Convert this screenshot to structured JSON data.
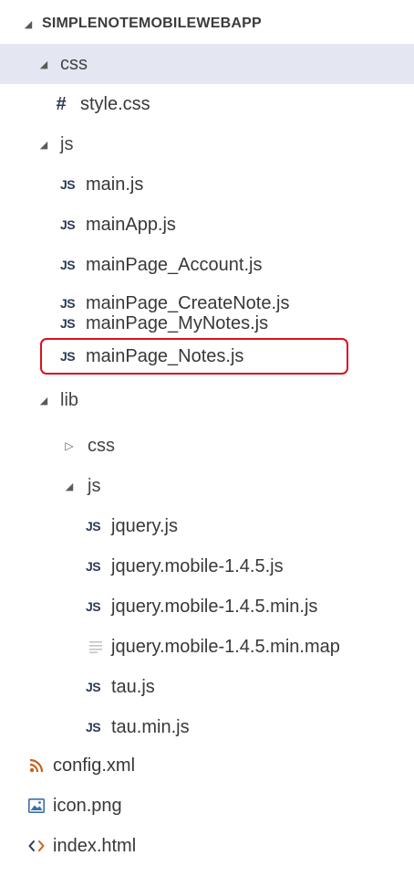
{
  "tree": {
    "root": {
      "label": "SIMPLENOTEMOBILEWEBAPP"
    },
    "css_folder": {
      "label": "css"
    },
    "style_css": {
      "label": "style.css"
    },
    "js_folder": {
      "label": "js"
    },
    "main_js": {
      "label": "main.js"
    },
    "mainApp_js": {
      "label": "mainApp.js"
    },
    "mainPage_Account_js": {
      "label": "mainPage_Account.js"
    },
    "mainPage_CreateNote_js": {
      "label": "mainPage_CreateNote.js"
    },
    "mainPage_MyNotes_js": {
      "label": "mainPage_MyNotes.js"
    },
    "mainPage_Notes_js": {
      "label": "mainPage_Notes.js"
    },
    "lib_folder": {
      "label": "lib"
    },
    "lib_css_folder": {
      "label": "css"
    },
    "lib_js_folder": {
      "label": "js"
    },
    "jquery_js": {
      "label": "jquery.js"
    },
    "jquery_mobile_js": {
      "label": "jquery.mobile-1.4.5.js"
    },
    "jquery_mobile_min_js": {
      "label": "jquery.mobile-1.4.5.min.js"
    },
    "jquery_mobile_min_map": {
      "label": "jquery.mobile-1.4.5.min.map"
    },
    "tau_js": {
      "label": "tau.js"
    },
    "tau_min_js": {
      "label": "tau.min.js"
    },
    "config_xml": {
      "label": "config.xml"
    },
    "icon_png": {
      "label": "icon.png"
    },
    "index_html": {
      "label": "index.html"
    }
  },
  "icons": {
    "js_glyph": "JS",
    "hash_glyph": "#",
    "expanded_twisty": "◢",
    "collapsed_twisty": "▷"
  },
  "colors": {
    "selected_row_bg": "#e4e6f1",
    "highlight_border": "#d8121e",
    "xml_icon": "#c7621a"
  }
}
